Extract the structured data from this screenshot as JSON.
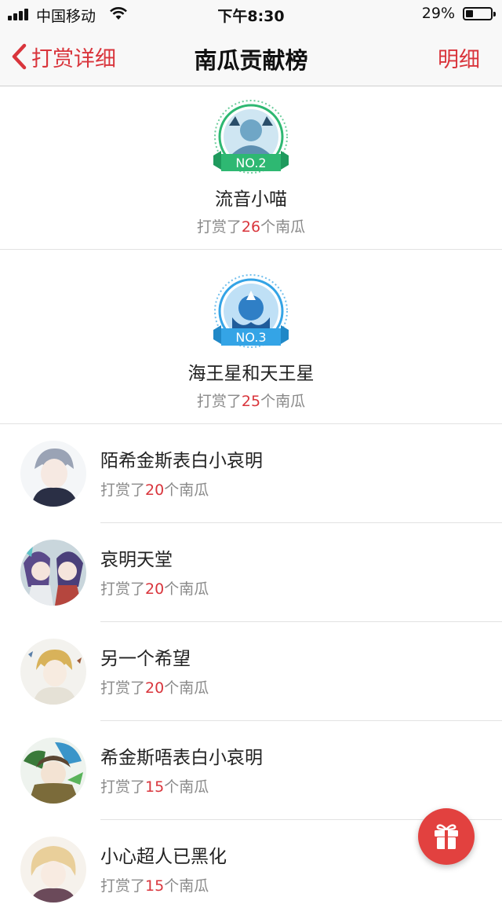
{
  "status_bar": {
    "carrier": "中国移动",
    "time": "下午8:30",
    "battery_percent": "29%",
    "battery_level": 0.29
  },
  "nav": {
    "back_label": "打赏详细",
    "title": "南瓜贡献榜",
    "detail_label": "明细"
  },
  "unit_prefix": "打赏了",
  "unit_suffix": "个南瓜",
  "podium": [
    {
      "rank_label": "NO.2",
      "name": "流音小喵",
      "count": "26",
      "color": "#2eb872"
    },
    {
      "rank_label": "NO.3",
      "name": "海王星和天王星",
      "count": "25",
      "color": "#34a4e6"
    }
  ],
  "list": [
    {
      "name": "陌希金斯表白小哀明",
      "count": "20"
    },
    {
      "name": "哀明天堂",
      "count": "20"
    },
    {
      "name": "另一个希望",
      "count": "20"
    },
    {
      "name": "希金斯唔表白小哀明",
      "count": "15"
    },
    {
      "name": "小心超人已黑化",
      "count": "15"
    }
  ],
  "colors": {
    "accent": "#d9353c",
    "gift_button": "#e2413f"
  },
  "icons": {
    "back": "chevron-left-icon",
    "gift": "gift-icon"
  }
}
